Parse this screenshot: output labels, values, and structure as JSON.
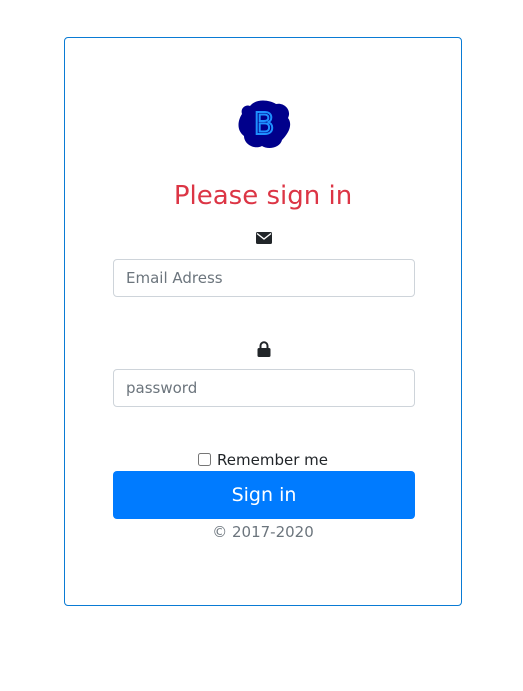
{
  "form": {
    "title": "Please sign in",
    "email_placeholder": "Email Adress",
    "password_placeholder": "password",
    "remember_label": "Remember me",
    "submit_label": "Sign in",
    "copyright": "© 2017-2020",
    "logo_letter": "B"
  },
  "icons": {
    "email": "envelope-icon",
    "password": "lock-icon",
    "logo": "bootstrap-logo"
  },
  "colors": {
    "title": "#dc3545",
    "button": "#007bff",
    "card_border": "#0a7bd4",
    "logo_blob": "#00008b",
    "logo_letter": "#1e90ff"
  }
}
